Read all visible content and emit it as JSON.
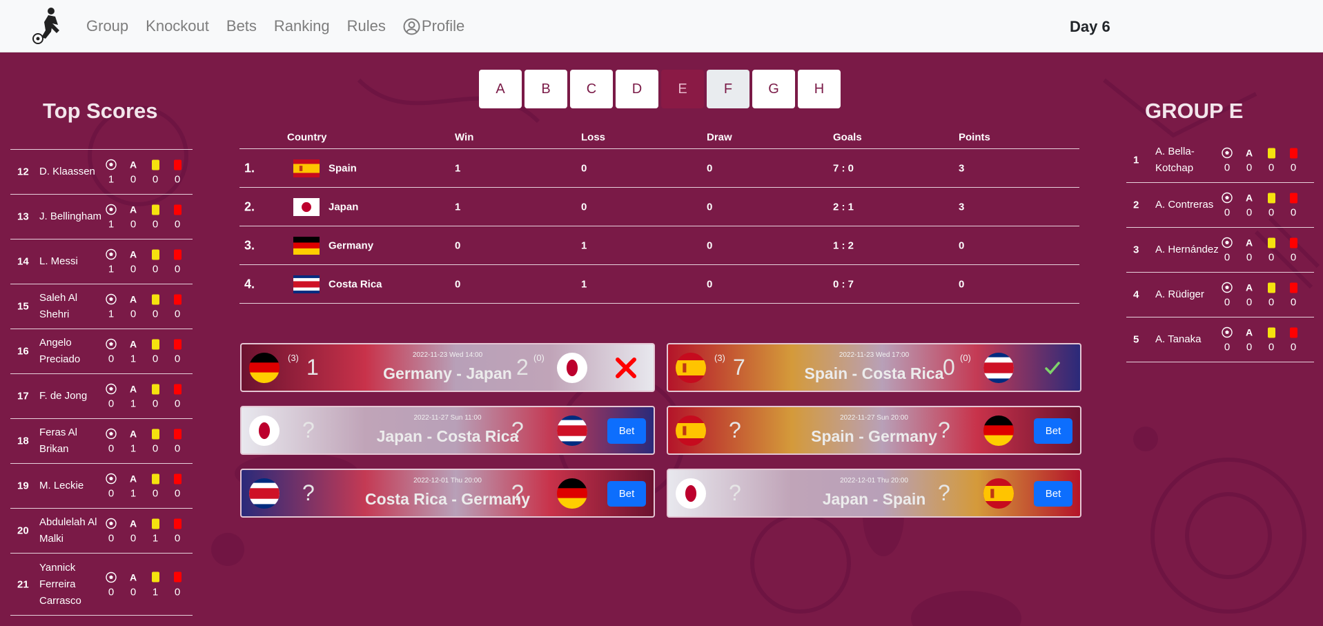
{
  "nav": {
    "links": [
      "Group",
      "Knockout",
      "Bets",
      "Ranking",
      "Rules",
      "Profile"
    ],
    "day": "Day 6"
  },
  "top_scores": {
    "title": "Top Scores",
    "stat_headers": {
      "assists": "A"
    },
    "players": [
      {
        "rank": "12",
        "name": "D. Klaassen",
        "goals": "1",
        "assists": "0",
        "yellow": "0",
        "red": "0"
      },
      {
        "rank": "13",
        "name": "J. Bellingham",
        "goals": "1",
        "assists": "0",
        "yellow": "0",
        "red": "0"
      },
      {
        "rank": "14",
        "name": "L. Messi",
        "goals": "1",
        "assists": "0",
        "yellow": "0",
        "red": "0"
      },
      {
        "rank": "15",
        "name": "Saleh Al Shehri",
        "goals": "1",
        "assists": "0",
        "yellow": "0",
        "red": "0"
      },
      {
        "rank": "16",
        "name": "Angelo Preciado",
        "goals": "0",
        "assists": "1",
        "yellow": "0",
        "red": "0"
      },
      {
        "rank": "17",
        "name": "F. de Jong",
        "goals": "0",
        "assists": "1",
        "yellow": "0",
        "red": "0"
      },
      {
        "rank": "18",
        "name": "Feras Al Brikan",
        "goals": "0",
        "assists": "1",
        "yellow": "0",
        "red": "0"
      },
      {
        "rank": "19",
        "name": "M. Leckie",
        "goals": "0",
        "assists": "1",
        "yellow": "0",
        "red": "0"
      },
      {
        "rank": "20",
        "name": "Abdulelah Al Malki",
        "goals": "0",
        "assists": "0",
        "yellow": "1",
        "red": "0"
      },
      {
        "rank": "21",
        "name": "Yannick Ferreira Carrasco",
        "goals": "0",
        "assists": "0",
        "yellow": "1",
        "red": "0"
      }
    ]
  },
  "group_players": {
    "title": "GROUP E",
    "players": [
      {
        "rank": "1",
        "name": "A. Bella-Kotchap",
        "goals": "0",
        "assists": "0",
        "yellow": "0",
        "red": "0"
      },
      {
        "rank": "2",
        "name": "A. Contreras",
        "goals": "0",
        "assists": "0",
        "yellow": "0",
        "red": "0"
      },
      {
        "rank": "3",
        "name": "A. Hernández",
        "goals": "0",
        "assists": "0",
        "yellow": "0",
        "red": "0"
      },
      {
        "rank": "4",
        "name": "A. Rüdiger",
        "goals": "0",
        "assists": "0",
        "yellow": "0",
        "red": "0"
      },
      {
        "rank": "5",
        "name": "A. Tanaka",
        "goals": "0",
        "assists": "0",
        "yellow": "0",
        "red": "0"
      }
    ]
  },
  "group_tabs": {
    "tabs": [
      "A",
      "B",
      "C",
      "D",
      "E",
      "F",
      "G",
      "H"
    ],
    "active": "E",
    "hovered": "F"
  },
  "standings": {
    "headers": {
      "country": "Country",
      "win": "Win",
      "loss": "Loss",
      "draw": "Draw",
      "goals": "Goals",
      "points": "Points"
    },
    "rows": [
      {
        "pos": "1.",
        "country": "Spain",
        "flag": "spain",
        "win": "1",
        "loss": "0",
        "draw": "0",
        "goals": "7 : 0",
        "points": "3"
      },
      {
        "pos": "2.",
        "country": "Japan",
        "flag": "japan",
        "win": "1",
        "loss": "0",
        "draw": "0",
        "goals": "2 : 1",
        "points": "3"
      },
      {
        "pos": "3.",
        "country": "Germany",
        "flag": "germany",
        "win": "0",
        "loss": "1",
        "draw": "0",
        "goals": "1 : 2",
        "points": "0"
      },
      {
        "pos": "4.",
        "country": "Costa Rica",
        "flag": "costa-rica",
        "win": "0",
        "loss": "1",
        "draw": "0",
        "goals": "0 : 7",
        "points": "0"
      }
    ]
  },
  "matches": [
    {
      "date": "2022-11-23 Wed 14:00",
      "teams": "Germany - Japan",
      "home_flag": "germany",
      "away_flag": "japan",
      "home_score": "1",
      "away_score": "2",
      "home_pred": "(3)",
      "away_pred": "(0)",
      "status": "wrong",
      "bet_label": ""
    },
    {
      "date": "2022-11-23 Wed 17:00",
      "teams": "Spain - Costa Rica",
      "home_flag": "spain",
      "away_flag": "costa-rica",
      "home_score": "7",
      "away_score": "0",
      "home_pred": "(3)",
      "away_pred": "(0)",
      "status": "correct",
      "bet_label": ""
    },
    {
      "date": "2022-11-27 Sun 11:00",
      "teams": "Japan - Costa Rica",
      "home_flag": "japan",
      "away_flag": "costa-rica",
      "home_score": "?",
      "away_score": "?",
      "home_pred": "",
      "away_pred": "",
      "status": "open",
      "bet_label": "Bet"
    },
    {
      "date": "2022-11-27 Sun 20:00",
      "teams": "Spain - Germany",
      "home_flag": "spain",
      "away_flag": "germany",
      "home_score": "?",
      "away_score": "?",
      "home_pred": "",
      "away_pred": "",
      "status": "open",
      "bet_label": "Bet"
    },
    {
      "date": "2022-12-01 Thu 20:00",
      "teams": "Costa Rica - Germany",
      "home_flag": "costa-rica",
      "away_flag": "germany",
      "home_score": "?",
      "away_score": "?",
      "home_pred": "",
      "away_pred": "",
      "status": "open",
      "bet_label": "Bet"
    },
    {
      "date": "2022-12-01 Thu 20:00",
      "teams": "Japan - Spain",
      "home_flag": "japan",
      "away_flag": "spain",
      "home_score": "?",
      "away_score": "?",
      "home_pred": "",
      "away_pred": "",
      "status": "open",
      "bet_label": "Bet"
    }
  ],
  "colors": {
    "background": "#7a1a47",
    "navbar": "#f8f9fa",
    "active_tab": "#8a1a45",
    "bet_button": "#0d6efd",
    "yellow_card": "#f5e20f",
    "red_card": "#ff0000",
    "wrong": "#ff0000",
    "correct": "#7fd36b"
  }
}
